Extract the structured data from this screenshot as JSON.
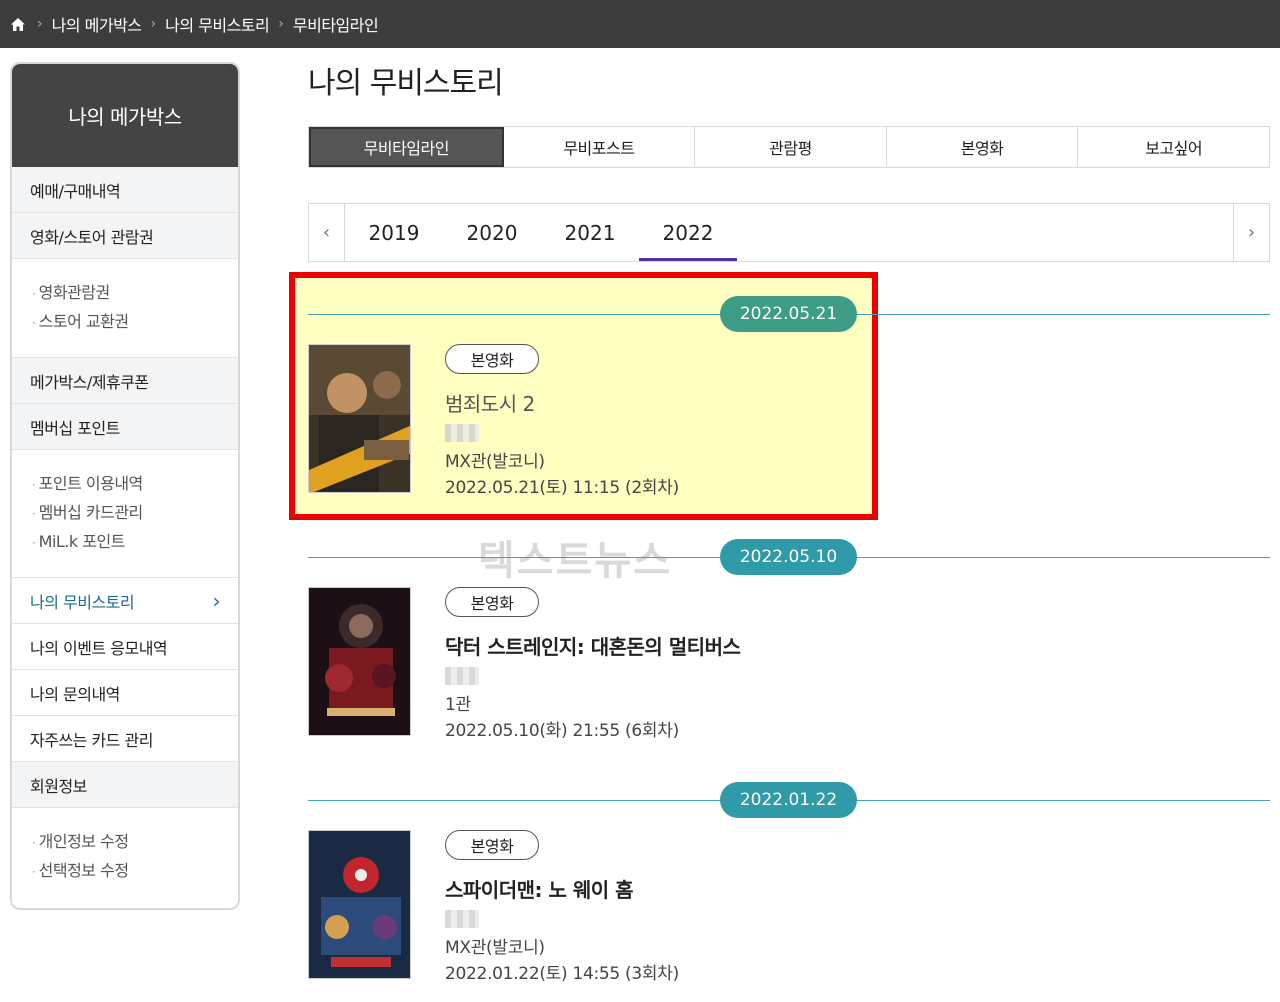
{
  "breadcrumb": {
    "items": [
      "나의 메가박스",
      "나의 무비스토리",
      "무비타임라인"
    ]
  },
  "sidebar": {
    "title": "나의 메가박스",
    "items": [
      {
        "label": "예매/구매내역"
      },
      {
        "label": "영화/스토어 관람권"
      },
      {
        "subs": [
          "영화관람권",
          "스토어 교환권"
        ]
      },
      {
        "label": "메가박스/제휴쿠폰"
      },
      {
        "label": "멤버십 포인트"
      },
      {
        "subs": [
          "포인트 이용내역",
          "멤버십 카드관리",
          "MiL.k 포인트"
        ]
      },
      {
        "label": "나의 무비스토리",
        "active": true
      },
      {
        "label": "나의 이벤트 응모내역"
      },
      {
        "label": "나의 문의내역"
      },
      {
        "label": "자주쓰는 카드 관리"
      },
      {
        "label": "회원정보"
      },
      {
        "subs": [
          "개인정보 수정",
          "선택정보 수정"
        ]
      }
    ]
  },
  "page_title": "나의 무비스토리",
  "tabs": [
    "무비타임라인",
    "무비포스트",
    "관람평",
    "본영화",
    "보고싶어"
  ],
  "active_tab": "무비타임라인",
  "years": [
    "2019",
    "2020",
    "2021",
    "2022"
  ],
  "active_year": "2022",
  "timeline": [
    {
      "date": "2022.05.21",
      "kind": "본영화",
      "title": "범죄도시 2",
      "screen": "MX관(발코니)",
      "showtime": "2022.05.21(토) 11:15 (2회차)",
      "badge_color": "#3d9d86"
    },
    {
      "date": "2022.05.10",
      "kind": "본영화",
      "title": "닥터 스트레인지: 대혼돈의 멀티버스",
      "screen": "1관",
      "showtime": "2022.05.10(화) 21:55 (6회차)",
      "badge_color": "#2f9aa8"
    },
    {
      "date": "2022.01.22",
      "kind": "본영화",
      "title": "스파이더맨: 노 웨이 홈",
      "screen": "MX관(발코니)",
      "showtime": "2022.01.22(토) 14:55 (3회차)",
      "badge_color": "#2f9aa8"
    }
  ],
  "watermark": "텍스트뉴스",
  "colors": {
    "highlight_border": "#ee0000",
    "highlight_fill": "#ffffc2",
    "year_underline": "#503396",
    "sidebar_active": "#1a6e8a"
  }
}
